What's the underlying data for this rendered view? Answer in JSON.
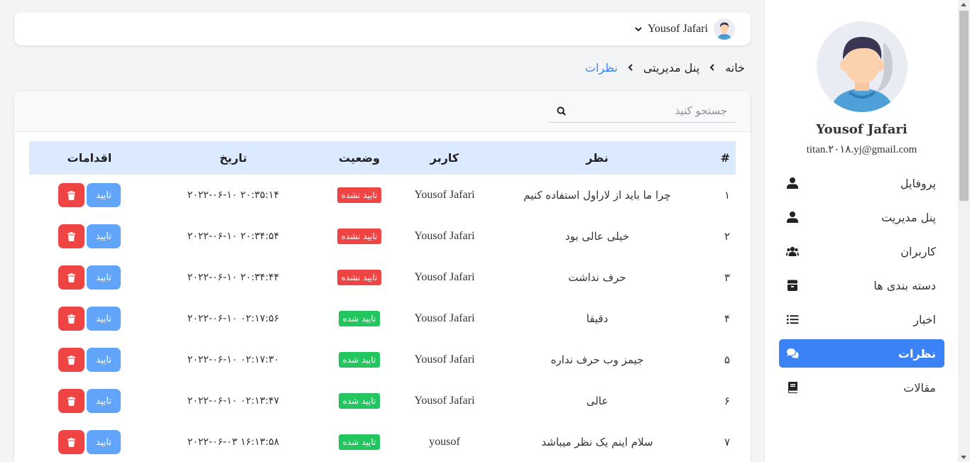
{
  "topbar": {
    "user_name": "Yousof Jafari"
  },
  "breadcrumb": {
    "home": "خانه",
    "panel": "پنل مدیریتی",
    "current": "نظرات"
  },
  "search": {
    "placeholder": "جستجو کنید"
  },
  "table": {
    "headers": {
      "num": "#",
      "comment": "نظر",
      "user": "کاربر",
      "status": "وضعیت",
      "date": "تاریخ",
      "actions": "اقدامات"
    },
    "approve_label": "تایید",
    "rows": [
      {
        "num": "۱",
        "comment": "چرا ما باید از لاراول استفاده کنیم",
        "user": "Yousof Jafari",
        "status": "تایید نشده",
        "approved": false,
        "date": "۲۰۲۲-۰۶-۱۰ ۲۰:۳۵:۱۴"
      },
      {
        "num": "۲",
        "comment": "خیلی عالی بود",
        "user": "Yousof Jafari",
        "status": "تایید نشده",
        "approved": false,
        "date": "۲۰۲۲-۰۶-۱۰ ۲۰:۳۴:۵۴"
      },
      {
        "num": "۳",
        "comment": "حرف نداشت",
        "user": "Yousof Jafari",
        "status": "تایید نشده",
        "approved": false,
        "date": "۲۰۲۲-۰۶-۱۰ ۲۰:۳۴:۴۴"
      },
      {
        "num": "۴",
        "comment": "دقیقا",
        "user": "Yousof Jafari",
        "status": "تایید شده",
        "approved": true,
        "date": "۲۰۲۲-۰۶-۱۰ ۰۲:۱۷:۵۶"
      },
      {
        "num": "۵",
        "comment": "جیمز وب حرف نداره",
        "user": "Yousof Jafari",
        "status": "تایید شده",
        "approved": true,
        "date": "۲۰۲۲-۰۶-۱۰ ۰۲:۱۷:۳۰"
      },
      {
        "num": "۶",
        "comment": "عالی",
        "user": "Yousof Jafari",
        "status": "تایید شده",
        "approved": true,
        "date": "۲۰۲۲-۰۶-۱۰ ۰۲:۱۳:۴۷"
      },
      {
        "num": "۷",
        "comment": "سلام اینم یک نظر میباشد",
        "user": "yousof",
        "status": "تایید شده",
        "approved": true,
        "date": "۲۰۲۲-۰۶-۰۳ ۱۶:۱۳:۵۸"
      }
    ]
  },
  "sidebar": {
    "name": "Yousof Jafari",
    "email": "titan.۲۰۱۸.yj@gmail.com",
    "items": [
      {
        "label": "پروفایل",
        "icon": "user-icon",
        "active": false
      },
      {
        "label": "پنل مدیریت",
        "icon": "user-icon",
        "active": false
      },
      {
        "label": "کاربران",
        "icon": "users-icon",
        "active": false
      },
      {
        "label": "دسته بندی ها",
        "icon": "box-icon",
        "active": false
      },
      {
        "label": "اخبار",
        "icon": "list-icon",
        "active": false
      },
      {
        "label": "نظرات",
        "icon": "comments-icon",
        "active": true
      },
      {
        "label": "مقالات",
        "icon": "book-icon",
        "active": false
      }
    ]
  },
  "colors": {
    "accent": "#3b82f6",
    "header_row": "#dbeafe",
    "danger": "#ef4444",
    "success": "#22c55e",
    "approve_btn": "#60a5fa"
  }
}
